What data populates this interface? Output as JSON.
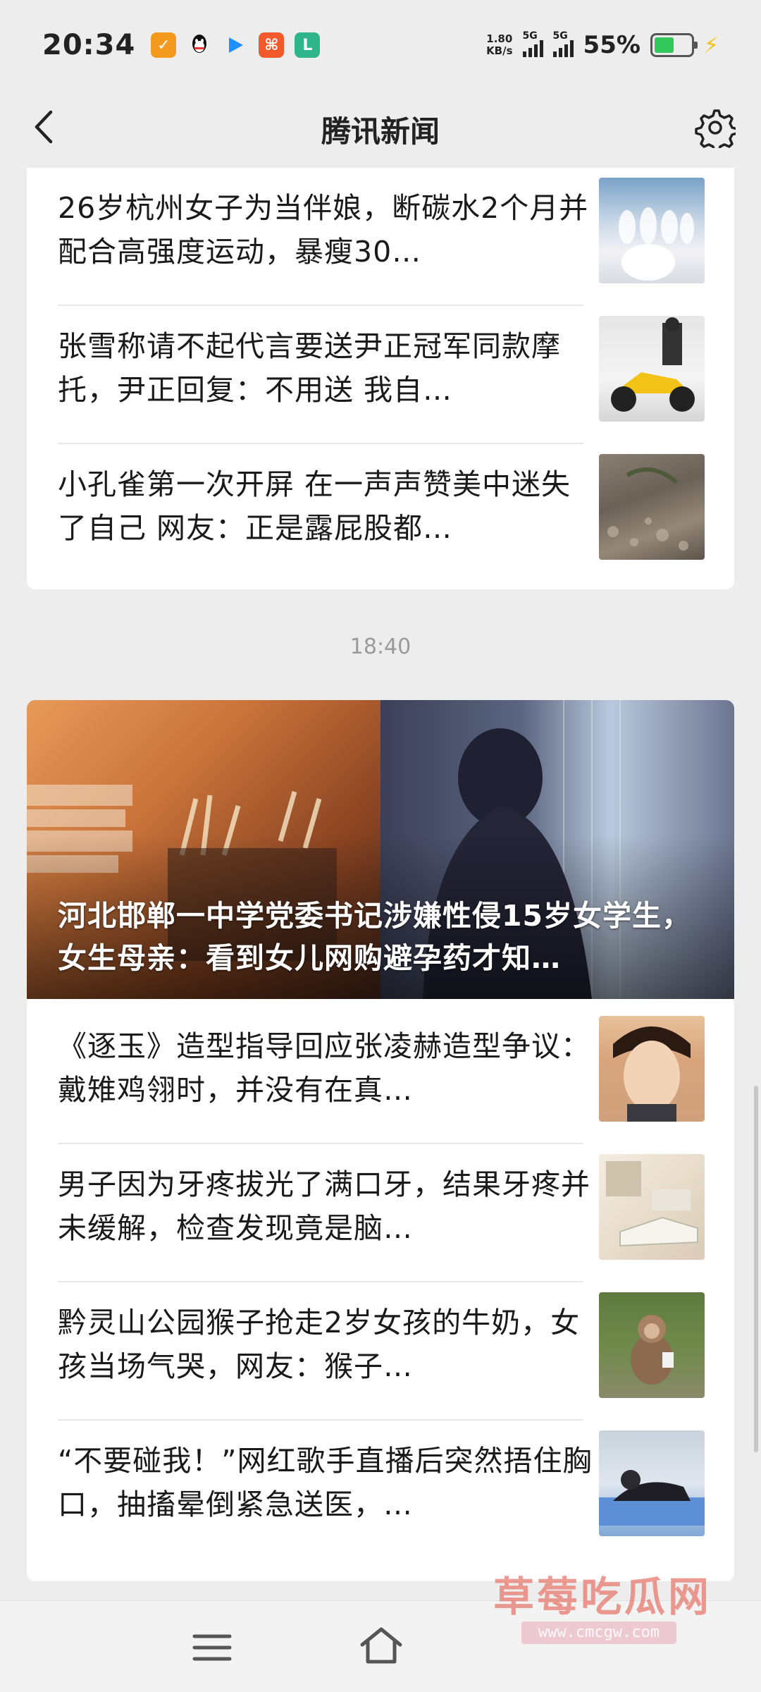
{
  "status_bar": {
    "time": "20:34",
    "net_speed_value": "1.80",
    "net_speed_unit": "KB/s",
    "signal_label_1": "5G",
    "signal_label_2": "5G",
    "battery_percent": "55%",
    "battery_level": 0.55,
    "apps": [
      "app-icon-1",
      "qq-icon",
      "app-icon-3",
      "app-icon-4",
      "app-icon-5"
    ]
  },
  "header": {
    "title": "腾讯新闻"
  },
  "feed_group_1": {
    "items": [
      {
        "title": "26岁杭州女子为当伴娘，断碳水2个月并配合高强度运动，暴瘦30…"
      },
      {
        "title": "张雪称请不起代言要送尹正冠军同款摩托，尹正回复：不用送 我自…"
      },
      {
        "title": "小孔雀第一次开屏 在一声声赞美中迷失了自己 网友：正是露屁股都…"
      }
    ]
  },
  "time_separator": "18:40",
  "feed_group_2": {
    "hero": {
      "title": "河北邯郸一中学党委书记涉嫌性侵15岁女学生，女生母亲：看到女儿网购避孕药才知…"
    },
    "items": [
      {
        "title": "《逐玉》造型指导回应张凌赫造型争议：戴雉鸡翎时，并没有在真…"
      },
      {
        "title": "男子因为牙疼拔光了满口牙，结果牙疼并未缓解，检查发现竟是脑…"
      },
      {
        "title": "黔灵山公园猴子抢走2岁女孩的牛奶，女孩当场气哭，网友：猴子…"
      },
      {
        "title": "“不要碰我！”网红歌手直播后突然捂住胸口，抽搐晕倒紧急送医，…"
      }
    ]
  },
  "watermark": {
    "text": "草莓吃瓜网",
    "url": "www.cmcgw.com"
  },
  "colors": {
    "background": "#ededed",
    "card": "#ffffff",
    "time_separator": "#9a9a9a",
    "battery": "#34c759"
  }
}
